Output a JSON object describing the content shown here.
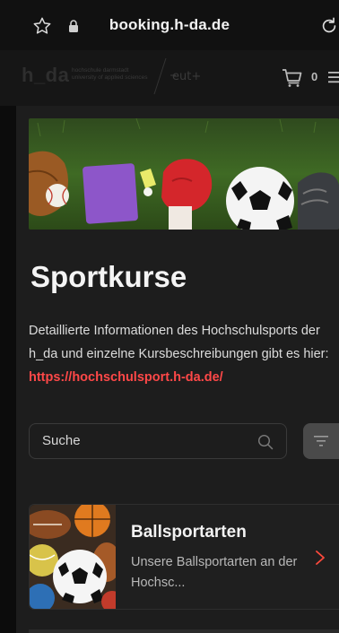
{
  "browser": {
    "url": "booking.h-da.de",
    "star_icon": "star-icon",
    "lock_icon": "lock-icon",
    "reload_icon": "reload-icon"
  },
  "header": {
    "logo_text": "h_da",
    "logo_subtext": "hochschule darmstadt university of applied sciences",
    "partner_logo_text": "eut+",
    "cart_count": "0",
    "cart_icon": "cart-icon",
    "menu_icon": "menu-icon"
  },
  "page": {
    "title": "Sportkurse",
    "intro_text": "Detaillierte Informationen des Hochschulsports der h_da und einzelne Kursbeschreibungen gibt es hier: ",
    "intro_link": "https://hochschulsport.h-da.de/"
  },
  "search": {
    "placeholder": "Suche",
    "value": ""
  },
  "categories": [
    {
      "title": "Ballsportarten",
      "description": "Unsere Ballsportarten an der Hochsc..."
    }
  ],
  "colors": {
    "accent_link": "#ff4848",
    "chevron": "#ff4a3d",
    "background": "#1d1d1d"
  }
}
